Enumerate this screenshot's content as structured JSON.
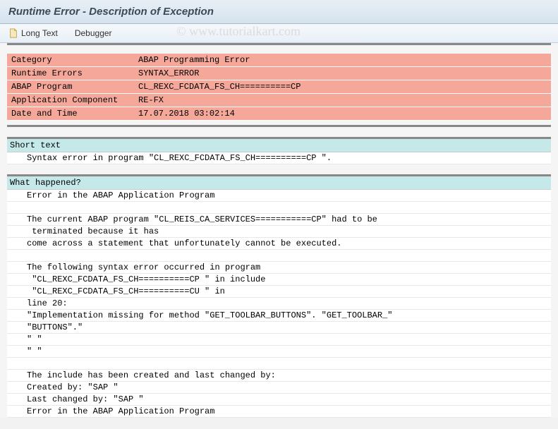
{
  "window": {
    "title": "Runtime Error - Description of Exception"
  },
  "toolbar": {
    "long_text_label": "Long Text",
    "debugger_label": "Debugger"
  },
  "info": {
    "rows": [
      {
        "label": "Category",
        "value": "ABAP Programming Error"
      },
      {
        "label": "Runtime Errors",
        "value": "SYNTAX_ERROR"
      },
      {
        "label": "ABAP Program",
        "value": "CL_REXC_FCDATA_FS_CH==========CP"
      },
      {
        "label": "Application Component",
        "value": "RE-FX"
      },
      {
        "label": "Date and Time",
        "value": "17.07.2018 03:02:14"
      }
    ]
  },
  "short_text": {
    "header": "Short text",
    "line": "Syntax error in program \"CL_REXC_FCDATA_FS_CH==========CP \"."
  },
  "what_happened": {
    "header": "What happened?",
    "lines": [
      "Error in the ABAP Application Program",
      "",
      "The current ABAP program \"CL_REIS_CA_SERVICES===========CP\" had to be",
      " terminated because it has",
      "come across a statement that unfortunately cannot be executed.",
      "",
      "The following syntax error occurred in program",
      " \"CL_REXC_FCDATA_FS_CH==========CP \" in include",
      " \"CL_REXC_FCDATA_FS_CH==========CU \" in",
      "line 20:",
      "\"Implementation missing for method \"GET_TOOLBAR_BUTTONS\". \"GET_TOOLBAR_\"",
      "\"BUTTONS\".\"",
      "\" \"",
      "\" \"",
      "",
      "The include has been created and last changed by:",
      "Created by: \"SAP \"",
      "Last changed by: \"SAP \"",
      "Error in the ABAP Application Program"
    ]
  },
  "watermark": "© www.tutorialkart.com"
}
